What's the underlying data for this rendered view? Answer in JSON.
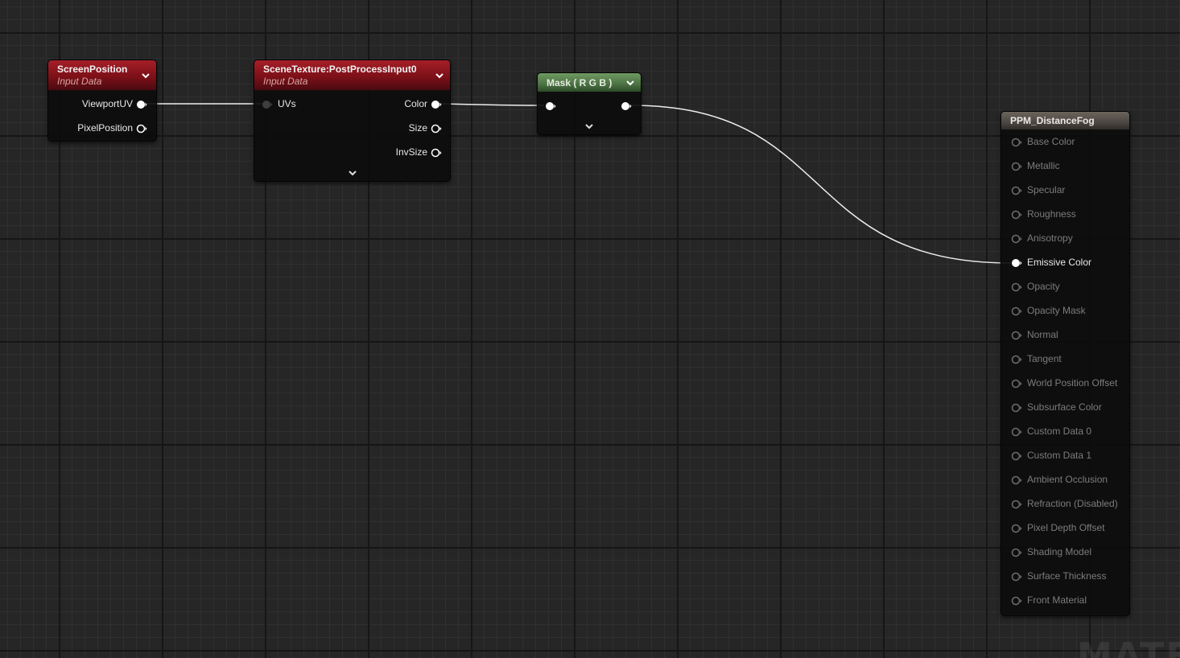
{
  "nodes": {
    "screen_position": {
      "title": "ScreenPosition",
      "subtitle": "Input Data",
      "outputs": [
        "ViewportUV",
        "PixelPosition"
      ]
    },
    "scene_texture": {
      "title": "SceneTexture:PostProcessInput0",
      "subtitle": "Input Data",
      "inputs": [
        "UVs"
      ],
      "outputs": [
        "Color",
        "Size",
        "InvSize"
      ]
    },
    "mask": {
      "title": "Mask ( R G B )"
    },
    "material": {
      "title": "PPM_DistanceFog",
      "inputs": [
        "Base Color",
        "Metallic",
        "Specular",
        "Roughness",
        "Anisotropy",
        "Emissive Color",
        "Opacity",
        "Opacity Mask",
        "Normal",
        "Tangent",
        "World Position Offset",
        "Subsurface Color",
        "Custom Data 0",
        "Custom Data 1",
        "Ambient Occlusion",
        "Refraction (Disabled)",
        "Pixel Depth Offset",
        "Shading Model",
        "Surface Thickness",
        "Front Material"
      ],
      "active_input": "Emissive Color"
    }
  },
  "watermark": "MATE",
  "colors": {
    "input_node_header": "#8a1520",
    "mask_node_header": "#5a8050",
    "material_node_header": "#5a544e",
    "wire": "#f0f0f0",
    "background": "#262626"
  }
}
